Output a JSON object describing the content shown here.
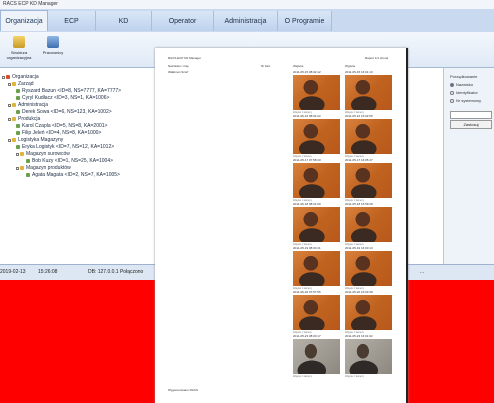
{
  "window": {
    "title": "RACS ECP KD Manager"
  },
  "tabs": [
    "Organizacja",
    "ECP",
    "KD",
    "Operator",
    "Administracja",
    "O Programie"
  ],
  "ribbon": {
    "structure_label": "Struktura organizacyjna",
    "employees_label": "Pracownicy"
  },
  "tree": [
    {
      "label": "Organizacja",
      "level": 0
    },
    {
      "label": "Zarząd",
      "level": 1
    },
    {
      "label": "Ryszard Bazun <ID=8, NS=7777, KA=7777>",
      "level": 2
    },
    {
      "label": "Cyryl Kudłacz <ID=3, NS=1, KA=1006>",
      "level": 2
    },
    {
      "label": "Administracja",
      "level": 1
    },
    {
      "label": "Derek Sowa <ID=6, NS=123, KA=1002>",
      "level": 2
    },
    {
      "label": "Produkcja",
      "level": 1
    },
    {
      "label": "Karol Czapla <ID=5, NS=8, KA=2001>",
      "level": 2
    },
    {
      "label": "Filip Jeleń <ID=4, NS=8, KA=1000>",
      "level": 2
    },
    {
      "label": "Logistyka Magazyny",
      "level": 1
    },
    {
      "label": "Eryka Logistyk <ID=7, NS=12, KA=1012>",
      "level": 2
    },
    {
      "label": "Magazyn surowców",
      "level": 2
    },
    {
      "label": "Bob Kuzy <ID=1, NS=25, KA=1004>",
      "level": 3
    },
    {
      "label": "Magazyn produktów",
      "level": 2
    },
    {
      "label": "Agata Magata <ID=2, NS=7, KA=1005>",
      "level": 3
    }
  ],
  "right_panel": {
    "title": "Porządkowanie",
    "options": [
      "Nazwisko",
      "Identyfikator",
      "Nr systemowy"
    ],
    "selected": "Nazwisko",
    "apply_label": "Zastosuj"
  },
  "status": {
    "date": "2019-02-13",
    "time": "15:26:08",
    "db": "DB: 127.0.0.1 Połączono",
    "extra": "..."
  },
  "document": {
    "header_left": "RACS ECP KD Manager",
    "header_right": "Raport 1/1 strona",
    "col_name_header": "Nazwisko i imię",
    "col_nr_header": "Nr kart.",
    "col_entry_header": "Wejście",
    "col_exit_header": "Wyjście",
    "person": "Walkman Szorf",
    "footer": "Wygenerowano RACS",
    "entries": [
      {
        "in": "2011-05-15 08:02:12",
        "out": "2011-05-15 16:01:10"
      },
      {
        "in": "2011-05-16 08:04:22",
        "out": "2011-05-16 16:02:05"
      },
      {
        "in": "2011-05-17 07:58:33",
        "out": "2011-05-17 16:05:47"
      },
      {
        "in": "2011-05-18 08:01:09",
        "out": "2011-05-18 15:59:28"
      },
      {
        "in": "2011-05-19 08:03:41",
        "out": "2011-05-19 16:00:13"
      },
      {
        "in": "2011-05-20 07:57:55",
        "out": "2011-05-20 16:03:38"
      },
      {
        "in": "2011-05-23 08:00:17",
        "out": "2011-05-23 16:01:02"
      }
    ],
    "photo_caption": "Zdjęcie z kamery"
  }
}
